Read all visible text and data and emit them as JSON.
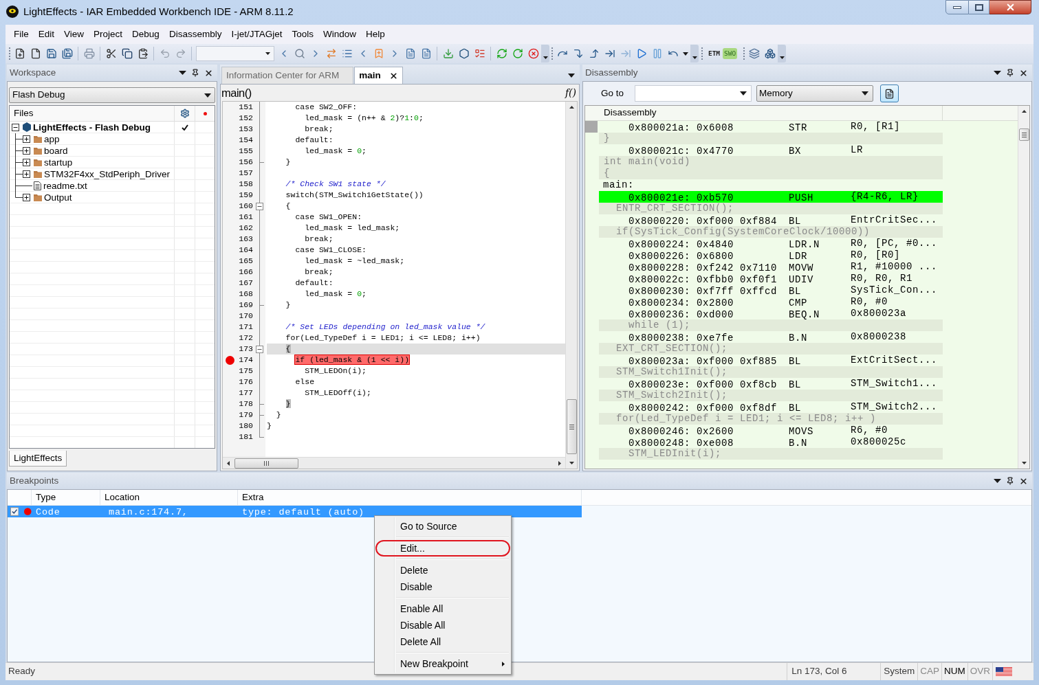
{
  "window": {
    "title": "LightEffects - IAR Embedded Workbench IDE - ARM 8.11.2"
  },
  "menu": [
    "File",
    "Edit",
    "View",
    "Project",
    "Debug",
    "Disassembly",
    "I-jet/JTAGjet",
    "Tools",
    "Window",
    "Help"
  ],
  "toolbar": {
    "trace_buttons": [
      {
        "label": "ETM",
        "kind": "plain"
      },
      {
        "label": "SWO",
        "kind": "badge"
      }
    ]
  },
  "workspace": {
    "title": "Workspace",
    "configuration": "Flash Debug",
    "files_header": "Files",
    "tree": [
      {
        "label": "LightEffects - Flash Debug",
        "kind": "project",
        "expanded": true,
        "checked": true,
        "children": [
          {
            "label": "app",
            "kind": "folder",
            "expanded": false,
            "checked": false
          },
          {
            "label": "board",
            "kind": "folder",
            "expanded": false,
            "checked": false
          },
          {
            "label": "startup",
            "kind": "folder",
            "expanded": false,
            "checked": false
          },
          {
            "label": "STM32F4xx_StdPeriph_Driver",
            "kind": "folder",
            "expanded": false,
            "checked": false
          },
          {
            "label": "readme.txt",
            "kind": "file",
            "checked": false
          },
          {
            "label": "Output",
            "kind": "folder",
            "expanded": false,
            "checked": false
          }
        ]
      }
    ],
    "tabs": [
      {
        "label": "LightEffects",
        "selected": true
      }
    ]
  },
  "editor": {
    "tabs": [
      {
        "label": "Information Center for ARM",
        "selected": false
      },
      {
        "label": "main",
        "selected": true
      }
    ],
    "function": "main()",
    "function_button": "f()",
    "lines": [
      {
        "number": "151",
        "kind": "code",
        "code": "      case SW2_OFF:",
        "fold_start": false,
        "fold_end": false,
        "breakpoint": false,
        "current": false,
        "brace_match": false
      },
      {
        "number": "152",
        "kind": "code",
        "code": "        led_mask = (n++ & 2)?1:0;",
        "fold_start": false,
        "fold_end": false,
        "breakpoint": false,
        "current": false,
        "brace_match": false
      },
      {
        "number": "153",
        "kind": "code",
        "code": "        break;",
        "fold_start": false,
        "fold_end": false,
        "breakpoint": false,
        "current": false,
        "brace_match": false
      },
      {
        "number": "154",
        "kind": "code",
        "code": "      default:",
        "fold_start": false,
        "fold_end": false,
        "breakpoint": false,
        "current": false,
        "brace_match": false
      },
      {
        "number": "155",
        "kind": "code",
        "code": "        led_mask = 0;",
        "fold_start": false,
        "fold_end": false,
        "breakpoint": false,
        "current": false,
        "brace_match": false
      },
      {
        "number": "156",
        "kind": "code",
        "code": "    }",
        "fold_start": false,
        "fold_end": true,
        "breakpoint": false,
        "current": false,
        "brace_match": false
      },
      {
        "number": "157",
        "kind": "blank",
        "fold_start": false,
        "fold_end": false,
        "breakpoint": false,
        "current": false
      },
      {
        "number": "158",
        "kind": "comment",
        "code": "    /* Check SW1 state */",
        "fold_start": false,
        "fold_end": false,
        "breakpoint": false,
        "current": false,
        "brace_match": false
      },
      {
        "number": "159",
        "kind": "code",
        "code": "    switch(STM_Switch1GetState())",
        "fold_start": false,
        "fold_end": false,
        "breakpoint": false,
        "current": false,
        "brace_match": false
      },
      {
        "number": "160",
        "kind": "code",
        "code": "    {",
        "fold_start": true,
        "fold_end": false,
        "breakpoint": false,
        "current": false,
        "brace_match": false
      },
      {
        "number": "161",
        "kind": "code",
        "code": "      case SW1_OPEN:",
        "fold_start": false,
        "fold_end": false,
        "breakpoint": false,
        "current": false,
        "brace_match": false
      },
      {
        "number": "162",
        "kind": "code",
        "code": "        led_mask = led_mask;",
        "fold_start": false,
        "fold_end": false,
        "breakpoint": false,
        "current": false,
        "brace_match": false
      },
      {
        "number": "163",
        "kind": "code",
        "code": "        break;",
        "fold_start": false,
        "fold_end": false,
        "breakpoint": false,
        "current": false,
        "brace_match": false
      },
      {
        "number": "164",
        "kind": "code",
        "code": "      case SW1_CLOSE:",
        "fold_start": false,
        "fold_end": false,
        "breakpoint": false,
        "current": false,
        "brace_match": false
      },
      {
        "number": "165",
        "kind": "code",
        "code": "        led_mask = ~led_mask;",
        "fold_start": false,
        "fold_end": false,
        "breakpoint": false,
        "current": false,
        "brace_match": false
      },
      {
        "number": "166",
        "kind": "code",
        "code": "        break;",
        "fold_start": false,
        "fold_end": false,
        "breakpoint": false,
        "current": false,
        "brace_match": false
      },
      {
        "number": "167",
        "kind": "code",
        "code": "      default:",
        "fold_start": false,
        "fold_end": false,
        "breakpoint": false,
        "current": false,
        "brace_match": false
      },
      {
        "number": "168",
        "kind": "code",
        "code": "        led_mask = 0;",
        "fold_start": false,
        "fold_end": false,
        "breakpoint": false,
        "current": false,
        "brace_match": false
      },
      {
        "number": "169",
        "kind": "code",
        "code": "    }",
        "fold_start": false,
        "fold_end": true,
        "breakpoint": false,
        "current": false,
        "brace_match": false
      },
      {
        "number": "170",
        "kind": "blank",
        "fold_start": false,
        "fold_end": false,
        "breakpoint": false,
        "current": false
      },
      {
        "number": "171",
        "kind": "comment",
        "code": "    /* Set LEDs depending on led_mask value */",
        "fold_start": false,
        "fold_end": false,
        "breakpoint": false,
        "current": false,
        "brace_match": false
      },
      {
        "number": "172",
        "kind": "code",
        "code": "    for(Led_TypeDef i = LED1; i <= LED8; i++)",
        "fold_start": false,
        "fold_end": false,
        "breakpoint": false,
        "current": false,
        "brace_match": false
      },
      {
        "number": "173",
        "kind": "code",
        "code": "    {",
        "fold_start": true,
        "fold_end": false,
        "breakpoint": false,
        "current": true,
        "brace_match": true
      },
      {
        "number": "174",
        "kind": "code",
        "code": "      if (led_mask & (1 << i))",
        "fold_start": false,
        "fold_end": false,
        "breakpoint": true,
        "current": false,
        "brace_match": false
      },
      {
        "number": "175",
        "kind": "code",
        "code": "        STM_LEDOn(i);",
        "fold_start": false,
        "fold_end": false,
        "breakpoint": false,
        "current": false,
        "brace_match": false
      },
      {
        "number": "176",
        "kind": "code",
        "code": "      else",
        "fold_start": false,
        "fold_end": false,
        "breakpoint": false,
        "current": false,
        "brace_match": false
      },
      {
        "number": "177",
        "kind": "code",
        "code": "        STM_LEDOff(i);",
        "fold_start": false,
        "fold_end": false,
        "breakpoint": false,
        "current": false,
        "brace_match": false
      },
      {
        "number": "178",
        "kind": "code",
        "code": "    }",
        "fold_start": false,
        "fold_end": true,
        "breakpoint": false,
        "current": false,
        "brace_match": true
      },
      {
        "number": "179",
        "kind": "code",
        "code": "  }",
        "fold_start": false,
        "fold_end": true,
        "breakpoint": false,
        "current": false,
        "brace_match": false
      },
      {
        "number": "180",
        "kind": "code",
        "code": "}",
        "fold_start": false,
        "fold_end": false,
        "breakpoint": false,
        "current": false,
        "brace_match": false
      },
      {
        "number": "181",
        "kind": "blank",
        "fold_start": false,
        "fold_end": true,
        "breakpoint": false,
        "current": false
      }
    ]
  },
  "disassembly": {
    "title": "Disassembly",
    "goto_label": "Go to",
    "view": "Memory",
    "column": "Disassembly",
    "rows": [
      {
        "kind": "instruction",
        "address": "0x800021a:",
        "bytes": "0x6008",
        "mnemonic": "STR",
        "operands": "R0, [R1]",
        "current": false,
        "marked": true
      },
      {
        "kind": "source",
        "text": "}",
        "current": false,
        "marked": false
      },
      {
        "kind": "instruction",
        "address": "0x800021c:",
        "bytes": "0x4770",
        "mnemonic": "BX",
        "operands": "LR",
        "current": false,
        "marked": false
      },
      {
        "kind": "source",
        "text": "int main(void)",
        "current": false,
        "marked": false
      },
      {
        "kind": "source",
        "text": "{",
        "current": false,
        "marked": false
      },
      {
        "kind": "label",
        "text": "main:",
        "current": false,
        "marked": false
      },
      {
        "kind": "instruction",
        "address": "0x800021e:",
        "bytes": "0xb570",
        "mnemonic": "PUSH",
        "operands": "{R4-R6, LR}",
        "current": true,
        "marked": false
      },
      {
        "kind": "source",
        "text": "  ENTR_CRT_SECTION();",
        "current": false,
        "marked": false
      },
      {
        "kind": "instruction",
        "address": "0x8000220:",
        "bytes": "0xf000 0xf884",
        "mnemonic": "BL",
        "operands": "EntrCritSec...",
        "current": false,
        "marked": false
      },
      {
        "kind": "source",
        "text": "  if(SysTick_Config(SystemCoreClock/10000))",
        "current": false,
        "marked": false
      },
      {
        "kind": "instruction",
        "address": "0x8000224:",
        "bytes": "0x4840",
        "mnemonic": "LDR.N",
        "operands": "R0, [PC, #0...",
        "current": false,
        "marked": false
      },
      {
        "kind": "instruction",
        "address": "0x8000226:",
        "bytes": "0x6800",
        "mnemonic": "LDR",
        "operands": "R0, [R0]",
        "current": false,
        "marked": false
      },
      {
        "kind": "instruction",
        "address": "0x8000228:",
        "bytes": "0xf242 0x7110",
        "mnemonic": "MOVW",
        "operands": "R1, #10000 ...",
        "current": false,
        "marked": false
      },
      {
        "kind": "instruction",
        "address": "0x800022c:",
        "bytes": "0xfbb0 0xf0f1",
        "mnemonic": "UDIV",
        "operands": "R0, R0, R1",
        "current": false,
        "marked": false
      },
      {
        "kind": "instruction",
        "address": "0x8000230:",
        "bytes": "0xf7ff 0xffcd",
        "mnemonic": "BL",
        "operands": "SysTick_Con...",
        "current": false,
        "marked": false
      },
      {
        "kind": "instruction",
        "address": "0x8000234:",
        "bytes": "0x2800",
        "mnemonic": "CMP",
        "operands": "R0, #0",
        "current": false,
        "marked": false
      },
      {
        "kind": "instruction",
        "address": "0x8000236:",
        "bytes": "0xd000",
        "mnemonic": "BEQ.N",
        "operands": "0x800023a",
        "current": false,
        "marked": false
      },
      {
        "kind": "source",
        "text": "    while (1);",
        "current": false,
        "marked": false
      },
      {
        "kind": "instruction",
        "address": "0x8000238:",
        "bytes": "0xe7fe",
        "mnemonic": "B.N",
        "operands": "0x8000238",
        "current": false,
        "marked": false
      },
      {
        "kind": "source",
        "text": "  EXT_CRT_SECTION();",
        "current": false,
        "marked": false
      },
      {
        "kind": "instruction",
        "address": "0x800023a:",
        "bytes": "0xf000 0xf885",
        "mnemonic": "BL",
        "operands": "ExtCritSect...",
        "current": false,
        "marked": false
      },
      {
        "kind": "source",
        "text": "  STM_Switch1Init();",
        "current": false,
        "marked": false
      },
      {
        "kind": "instruction",
        "address": "0x800023e:",
        "bytes": "0xf000 0xf8cb",
        "mnemonic": "BL",
        "operands": "STM_Switch1...",
        "current": false,
        "marked": false
      },
      {
        "kind": "source",
        "text": "  STM_Switch2Init();",
        "current": false,
        "marked": false
      },
      {
        "kind": "instruction",
        "address": "0x8000242:",
        "bytes": "0xf000 0xf8df",
        "mnemonic": "BL",
        "operands": "STM_Switch2...",
        "current": false,
        "marked": false
      },
      {
        "kind": "source",
        "text": "  for(Led_TypeDef i = LED1; i <= LED8; i++ )",
        "current": false,
        "marked": false
      },
      {
        "kind": "instruction",
        "address": "0x8000246:",
        "bytes": "0x2600",
        "mnemonic": "MOVS",
        "operands": "R6, #0",
        "current": false,
        "marked": false
      },
      {
        "kind": "instruction",
        "address": "0x8000248:",
        "bytes": "0xe008",
        "mnemonic": "B.N",
        "operands": "0x800025c",
        "current": false,
        "marked": false
      },
      {
        "kind": "source",
        "text": "    STM_LEDInit(i);",
        "current": false,
        "marked": false
      }
    ]
  },
  "breakpoints": {
    "title": "Breakpoints",
    "columns": [
      "Type",
      "Location",
      "Extra"
    ],
    "rows": [
      {
        "checked": true,
        "selected": true,
        "type": "Code",
        "location": "main.c:174.7,",
        "extra": "type: default (auto)"
      }
    ]
  },
  "context_menu": {
    "items": [
      {
        "kind": "item",
        "label": "Go to Source",
        "circled": false
      },
      {
        "kind": "separator"
      },
      {
        "kind": "item",
        "label": "Edit...",
        "circled": true
      },
      {
        "kind": "separator"
      },
      {
        "kind": "item",
        "label": "Delete",
        "circled": false
      },
      {
        "kind": "item",
        "label": "Disable",
        "circled": false
      },
      {
        "kind": "separator"
      },
      {
        "kind": "item",
        "label": "Enable All",
        "circled": false
      },
      {
        "kind": "item",
        "label": "Disable All",
        "circled": false
      },
      {
        "kind": "item",
        "label": "Delete All",
        "circled": false
      },
      {
        "kind": "separator"
      },
      {
        "kind": "submenu",
        "label": "New Breakpoint",
        "circled": false
      }
    ]
  },
  "status_bar": {
    "message": "Ready",
    "position": "Ln 173, Col 6",
    "mode": "System",
    "indicators": [
      {
        "label": "CAP",
        "on": false
      },
      {
        "label": "NUM",
        "on": true
      },
      {
        "label": "OVR",
        "on": false
      }
    ]
  }
}
